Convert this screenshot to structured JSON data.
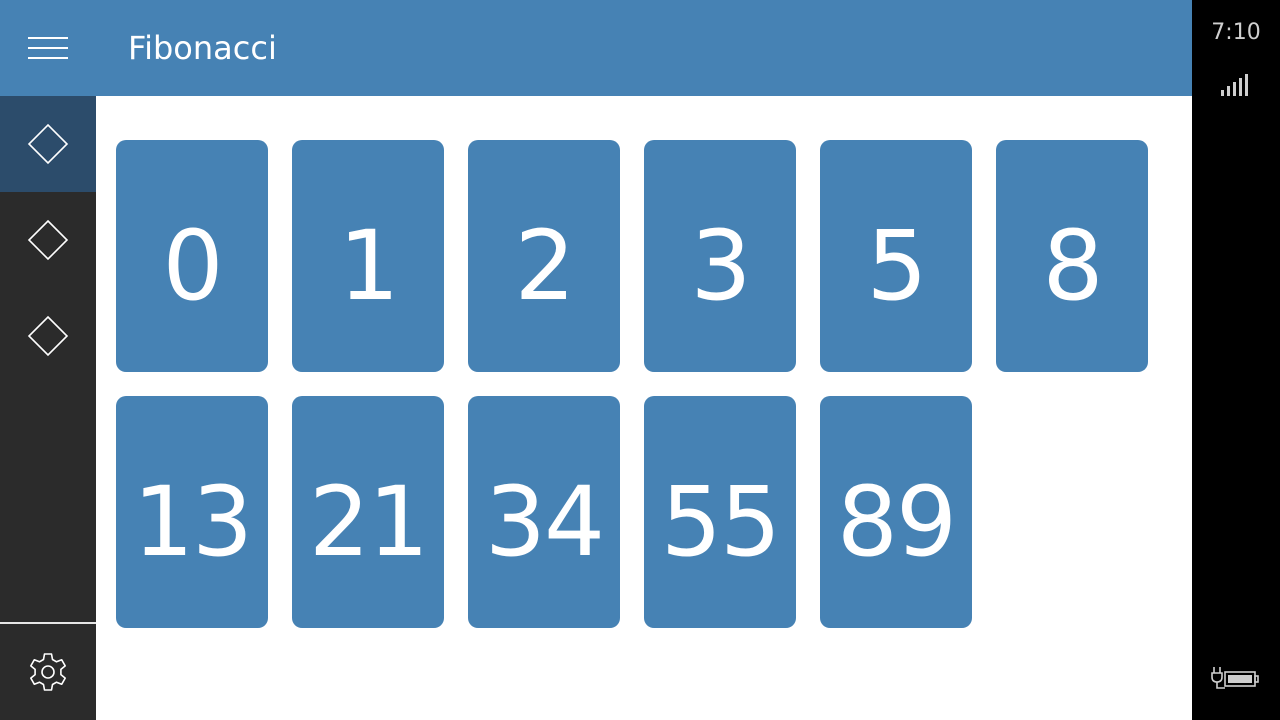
{
  "app": {
    "title": "Fibonacci"
  },
  "nav": {
    "items": [
      {
        "icon": "diamond-icon",
        "selected": true
      },
      {
        "icon": "diamond-icon",
        "selected": false
      },
      {
        "icon": "diamond-icon",
        "selected": false
      }
    ],
    "settings_icon": "gear-icon"
  },
  "tiles": [
    "0",
    "1",
    "2",
    "3",
    "5",
    "8",
    "13",
    "21",
    "34",
    "55",
    "89"
  ],
  "status": {
    "time": "7:10",
    "signal_icon": "signal-icon",
    "battery_icon": "battery-charging-icon"
  },
  "colors": {
    "accent": "#4682b4",
    "nav_selected": "#2c4c6b",
    "sidebar": "#2b2b2b",
    "statusbar": "#000000"
  }
}
